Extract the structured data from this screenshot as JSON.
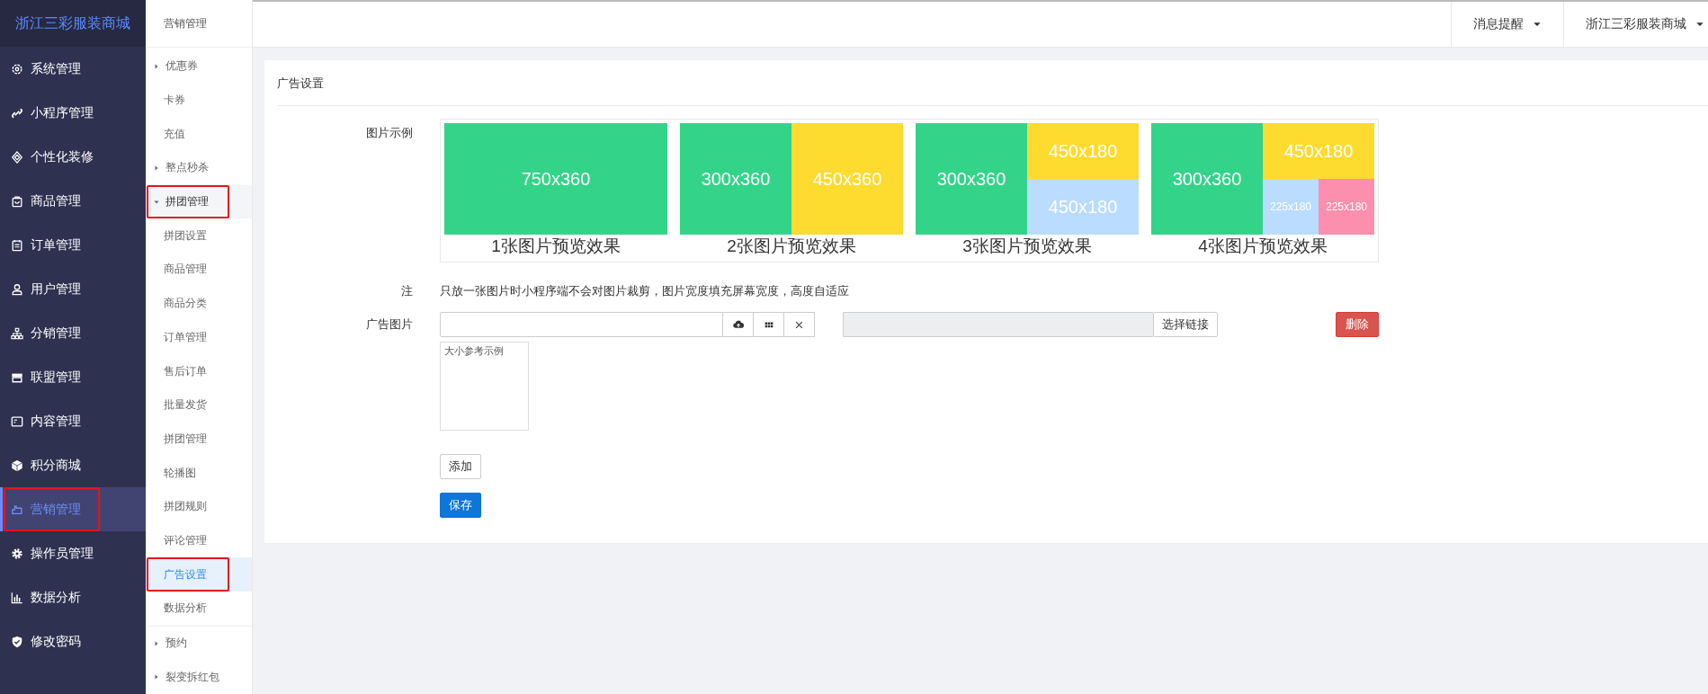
{
  "brand": "浙江三彩服装商城",
  "nav": [
    {
      "label": "系统管理",
      "selected": false,
      "highlighted": false
    },
    {
      "label": "小程序管理",
      "selected": false,
      "highlighted": false
    },
    {
      "label": "个性化装修",
      "selected": false,
      "highlighted": false
    },
    {
      "label": "商品管理",
      "selected": false,
      "highlighted": false
    },
    {
      "label": "订单管理",
      "selected": false,
      "highlighted": false
    },
    {
      "label": "用户管理",
      "selected": false,
      "highlighted": false
    },
    {
      "label": "分销管理",
      "selected": false,
      "highlighted": false
    },
    {
      "label": "联盟管理",
      "selected": false,
      "highlighted": false
    },
    {
      "label": "内容管理",
      "selected": false,
      "highlighted": false
    },
    {
      "label": "积分商城",
      "selected": false,
      "highlighted": false
    },
    {
      "label": "营销管理",
      "selected": true,
      "highlighted": true
    },
    {
      "label": "操作员管理",
      "selected": false,
      "highlighted": false
    },
    {
      "label": "数据分析",
      "selected": false,
      "highlighted": false
    },
    {
      "label": "修改密码",
      "selected": false,
      "highlighted": false
    }
  ],
  "submenu": {
    "title": "营销管理",
    "items": [
      {
        "label": "优惠券",
        "kind": "group",
        "expanded": false,
        "highlighted": false
      },
      {
        "label": "卡券",
        "kind": "link",
        "selected": false,
        "highlighted": false
      },
      {
        "label": "充值",
        "kind": "link",
        "selected": false,
        "highlighted": false
      },
      {
        "label": "整点秒杀",
        "kind": "group",
        "expanded": false,
        "highlighted": false
      },
      {
        "label": "拼团管理",
        "kind": "group",
        "expanded": true,
        "highlighted": true,
        "children": [
          {
            "label": "拼团设置",
            "selected": false,
            "highlighted": false
          },
          {
            "label": "商品管理",
            "selected": false,
            "highlighted": false
          },
          {
            "label": "商品分类",
            "selected": false,
            "highlighted": false
          },
          {
            "label": "订单管理",
            "selected": false,
            "highlighted": false
          },
          {
            "label": "售后订单",
            "selected": false,
            "highlighted": false
          },
          {
            "label": "批量发货",
            "selected": false,
            "highlighted": false
          },
          {
            "label": "拼团管理",
            "selected": false,
            "highlighted": false
          },
          {
            "label": "轮播图",
            "selected": false,
            "highlighted": false
          },
          {
            "label": "拼团规则",
            "selected": false,
            "highlighted": false
          },
          {
            "label": "评论管理",
            "selected": false,
            "highlighted": false
          },
          {
            "label": "广告设置",
            "selected": true,
            "highlighted": true
          },
          {
            "label": "数据分析",
            "selected": false,
            "highlighted": false
          }
        ]
      },
      {
        "label": "预约",
        "kind": "group",
        "expanded": false,
        "highlighted": false
      },
      {
        "label": "裂变拆红包",
        "kind": "group",
        "expanded": false,
        "highlighted": false
      }
    ]
  },
  "header": {
    "menus": [
      {
        "label": "消息提醒"
      },
      {
        "label": "浙江三彩服装商城"
      }
    ]
  },
  "card": {
    "title": "广告设置",
    "example_label": "图片示例",
    "previews": [
      {
        "caption": "1张图片预览效果",
        "tiles": [
          {
            "label": "750x360",
            "color": "#33d48a"
          }
        ]
      },
      {
        "caption": "2张图片预览效果",
        "tiles": [
          {
            "label": "300x360",
            "color": "#33d48a"
          },
          {
            "label": "450x360",
            "color": "#fddb2f"
          }
        ]
      },
      {
        "caption": "3张图片预览效果",
        "tiles": [
          {
            "label": "300x360",
            "color": "#33d48a"
          },
          {
            "label": "450x180",
            "color": "#fddb2f"
          },
          {
            "label": "450x180",
            "color": "#b9dcff"
          }
        ]
      },
      {
        "caption": "4张图片预览效果",
        "tiles": [
          {
            "label": "300x360",
            "color": "#33d48a"
          },
          {
            "label": "450x180",
            "color": "#fddb2f"
          },
          {
            "label": "225x180",
            "color": "#b9dcff"
          },
          {
            "label": "225x180",
            "color": "#fd8fae"
          }
        ]
      }
    ],
    "note_label": "注",
    "note": "只放一张图片时小程序端不会对图片裁剪，图片宽度填充屏幕宽度，高度自适应",
    "image_label": "广告图片",
    "choose_link": "选择链接",
    "delete": "删除",
    "reference": "大小参考示例",
    "add": "添加",
    "save": "保存"
  }
}
